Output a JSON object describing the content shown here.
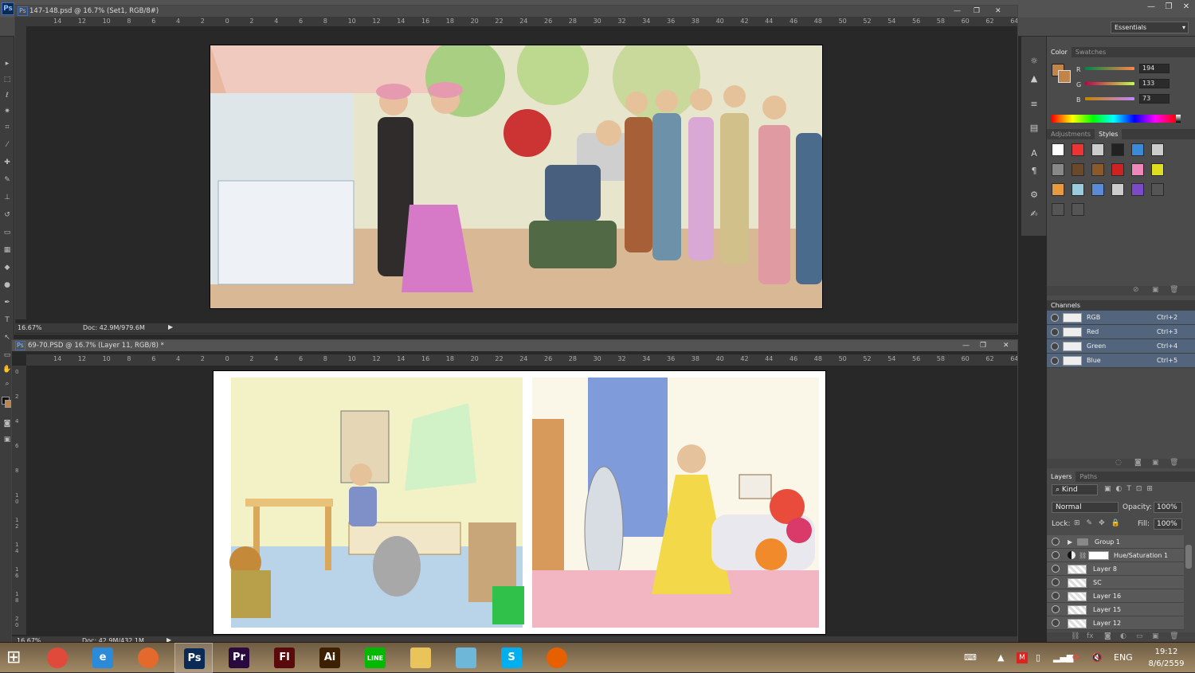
{
  "app": {
    "logo": "Ps",
    "workspace": "Essentials"
  },
  "doc1": {
    "title": "147-148.psd @ 16.7% (Set1, RGB/8#)",
    "zoom": "16.67%",
    "doc_info": "Doc: 42.9M/979.6M",
    "ruler": [
      "14",
      "12",
      "10",
      "8",
      "6",
      "4",
      "2",
      "0",
      "2",
      "4",
      "6",
      "8",
      "10",
      "12",
      "14",
      "16",
      "18",
      "20",
      "22",
      "24",
      "26",
      "28",
      "30",
      "32",
      "34",
      "36",
      "38",
      "40",
      "42",
      "44",
      "46",
      "48",
      "50",
      "52",
      "54",
      "56",
      "58",
      "60",
      "62",
      "64"
    ]
  },
  "doc2": {
    "title": "69-70.PSD @ 16.7% (Layer 11, RGB/8) *",
    "zoom": "16.67%",
    "doc_info": "Doc: 42.9M/432.1M",
    "ruler": [
      "14",
      "12",
      "10",
      "8",
      "6",
      "4",
      "2",
      "0",
      "2",
      "4",
      "6",
      "8",
      "10",
      "12",
      "14",
      "16",
      "18",
      "20",
      "22",
      "24",
      "26",
      "28",
      "30",
      "32",
      "34",
      "36",
      "38",
      "40",
      "42",
      "44",
      "46",
      "48",
      "50",
      "52",
      "54",
      "56",
      "58",
      "60",
      "62",
      "64"
    ],
    "vruler": [
      "0",
      "2",
      "4",
      "6",
      "8",
      "1 0",
      "1 2",
      "1 4",
      "1 6",
      "1 8",
      "2 0"
    ]
  },
  "color_panel": {
    "tabs": [
      "Color",
      "Swatches"
    ],
    "r_label": "R",
    "g_label": "G",
    "b_label": "B",
    "r": "194",
    "g": "133",
    "b": "73",
    "swatch": "#c28549"
  },
  "adjust_panel": {
    "tabs": [
      "Adjustments",
      "Styles"
    ]
  },
  "channels": {
    "title": "Channels",
    "rows": [
      {
        "name": "RGB",
        "shortcut": "Ctrl+2"
      },
      {
        "name": "Red",
        "shortcut": "Ctrl+3"
      },
      {
        "name": "Green",
        "shortcut": "Ctrl+4"
      },
      {
        "name": "Blue",
        "shortcut": "Ctrl+5"
      }
    ]
  },
  "layers": {
    "tabs": [
      "Layers",
      "Paths"
    ],
    "kind": "Kind",
    "blend": "Normal",
    "opacity_label": "Opacity:",
    "opacity": "100%",
    "lock_label": "Lock:",
    "fill_label": "Fill:",
    "fill": "100%",
    "rows": [
      {
        "name": "Group 1",
        "type": "group"
      },
      {
        "name": "Hue/Saturation 1",
        "type": "adjustment"
      },
      {
        "name": "Layer 8",
        "type": "layer"
      },
      {
        "name": "SC",
        "type": "layer"
      },
      {
        "name": "Layer 16",
        "type": "layer"
      },
      {
        "name": "Layer 15",
        "type": "layer"
      },
      {
        "name": "Layer 12",
        "type": "layer"
      }
    ]
  },
  "taskbar": {
    "lang": "ENG",
    "time": "19:12",
    "date": "8/6/2559",
    "apps": [
      {
        "label": "",
        "icon": "chrome-icon",
        "color": "#e04a3a"
      },
      {
        "label": "e",
        "icon": "internet-explorer-icon",
        "color": "#2b8bd8"
      },
      {
        "label": "",
        "icon": "orange-app-icon",
        "color": "#e36a2c"
      },
      {
        "label": "Ps",
        "icon": "photoshop-icon",
        "color": "#0b2a55"
      },
      {
        "label": "Pr",
        "icon": "premiere-icon",
        "color": "#2a0a3e"
      },
      {
        "label": "Fl",
        "icon": "flash-icon",
        "color": "#5a0a0a"
      },
      {
        "label": "Ai",
        "icon": "illustrator-icon",
        "color": "#3d2000"
      },
      {
        "label": "LINE",
        "icon": "line-icon",
        "color": "#00b900"
      },
      {
        "label": "",
        "icon": "file-explorer-icon",
        "color": "#e8c45a"
      },
      {
        "label": "",
        "icon": "window-app-icon",
        "color": "#6fb7d8"
      },
      {
        "label": "S",
        "icon": "skype-icon",
        "color": "#00aff0"
      },
      {
        "label": "",
        "icon": "firefox-icon",
        "color": "#e66000"
      }
    ]
  }
}
